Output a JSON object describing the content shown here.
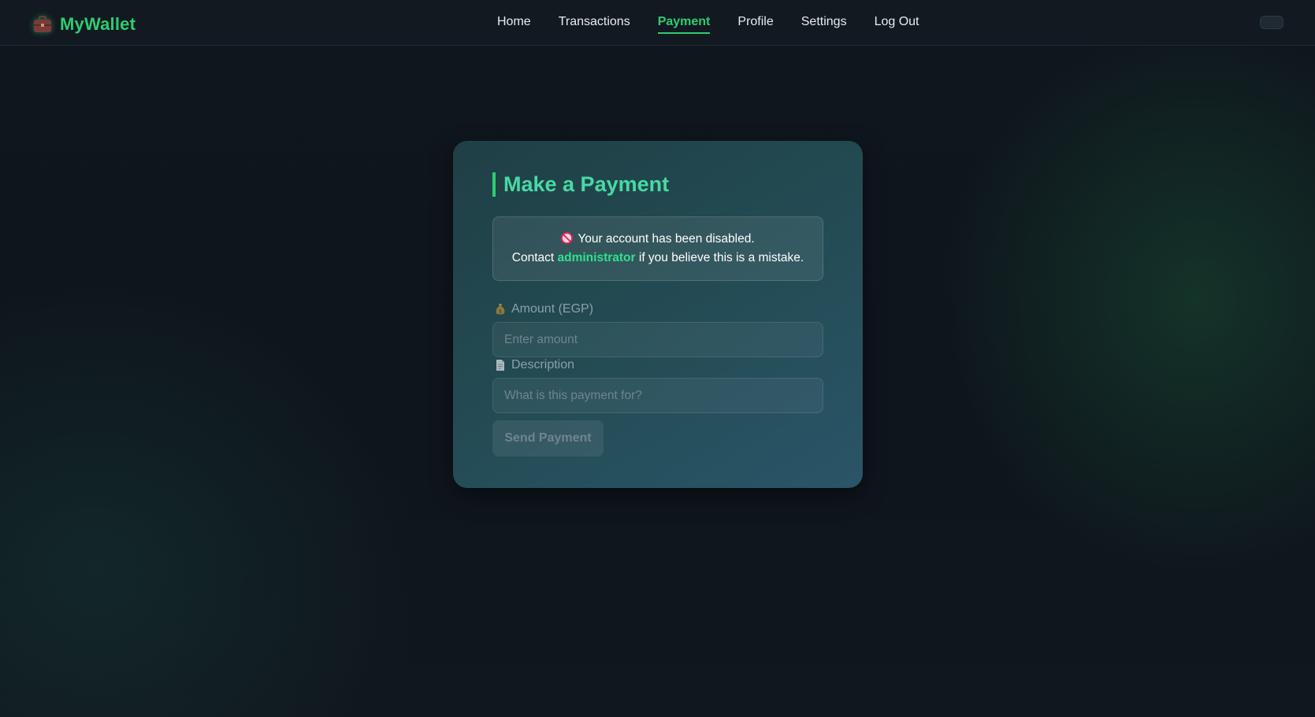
{
  "brand": {
    "icon": "briefcase-icon",
    "name": "MyWallet",
    "color": "#2ecc71"
  },
  "nav": {
    "items": [
      {
        "label": "Home",
        "active": false
      },
      {
        "label": "Transactions",
        "active": false
      },
      {
        "label": "Payment",
        "active": true
      },
      {
        "label": "Profile",
        "active": false
      },
      {
        "label": "Settings",
        "active": false
      },
      {
        "label": "Log Out",
        "active": false
      }
    ],
    "accent": "#2ecc71"
  },
  "theme_toggle": {
    "icon": "toggle-switch"
  },
  "payment": {
    "title": "Make a Payment",
    "alert": {
      "icon": "no-entry-icon",
      "line1": "Your account has been disabled.",
      "line2_prefix": "Contact",
      "line2_link": "administrator",
      "line2_suffix": "if you believe this is a mistake."
    },
    "amount": {
      "icon": "money-bag-icon",
      "label": "Amount (EGP)",
      "placeholder": "Enter amount",
      "value": ""
    },
    "description": {
      "icon": "document-icon",
      "label": "Description",
      "placeholder": "What is this payment for?",
      "value": ""
    },
    "submit_label": "Send Payment",
    "disabled": true
  }
}
